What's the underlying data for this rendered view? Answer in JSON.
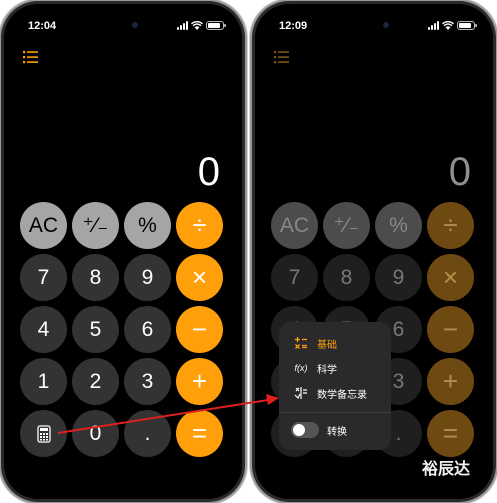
{
  "left_screen": {
    "status_time": "12:04",
    "display_value": "0",
    "keys": [
      {
        "label": "AC",
        "kind": "func"
      },
      {
        "label": "⁺∕₋",
        "kind": "func"
      },
      {
        "label": "%",
        "kind": "func"
      },
      {
        "label": "÷",
        "kind": "op"
      },
      {
        "label": "7",
        "kind": "num"
      },
      {
        "label": "8",
        "kind": "num"
      },
      {
        "label": "9",
        "kind": "num"
      },
      {
        "label": "×",
        "kind": "op"
      },
      {
        "label": "4",
        "kind": "num"
      },
      {
        "label": "5",
        "kind": "num"
      },
      {
        "label": "6",
        "kind": "num"
      },
      {
        "label": "−",
        "kind": "op"
      },
      {
        "label": "1",
        "kind": "num"
      },
      {
        "label": "2",
        "kind": "num"
      },
      {
        "label": "3",
        "kind": "num"
      },
      {
        "label": "+",
        "kind": "op"
      },
      {
        "label": "calculator-icon",
        "kind": "num"
      },
      {
        "label": "0",
        "kind": "num"
      },
      {
        "label": ".",
        "kind": "num"
      },
      {
        "label": "=",
        "kind": "op"
      }
    ]
  },
  "right_screen": {
    "status_time": "12:09",
    "display_value": "0",
    "popup": {
      "items": [
        {
          "label": "基础",
          "icon": "basic-ops-icon",
          "selected": true
        },
        {
          "label": "科学",
          "icon": "fx-icon",
          "icon_text": "f(x)",
          "selected": false
        },
        {
          "label": "数学备忘录",
          "icon": "math-notes-icon",
          "selected": false
        }
      ],
      "toggle_label": "转换",
      "toggle_on": false
    }
  },
  "watermark": "裕辰达",
  "colors": {
    "accent": "#ff9f0a",
    "func_key": "#a5a5a5",
    "num_key": "#333333",
    "arrow": "#e02020"
  }
}
